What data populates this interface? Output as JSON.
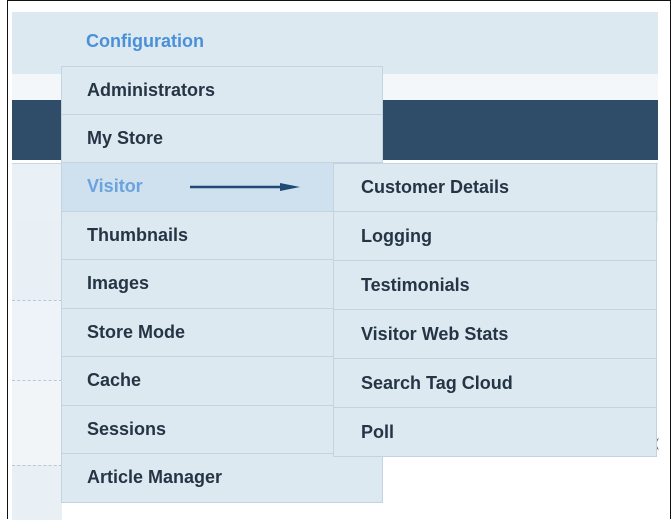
{
  "header": {
    "title": "Configuration"
  },
  "menu": {
    "items": [
      {
        "label": "Administrators"
      },
      {
        "label": "My Store"
      },
      {
        "label": "Visitor",
        "active": true
      },
      {
        "label": "Thumbnails"
      },
      {
        "label": "Images"
      },
      {
        "label": "Store Mode"
      },
      {
        "label": "Cache"
      },
      {
        "label": "Sessions"
      },
      {
        "label": "Article Manager"
      }
    ]
  },
  "submenu": {
    "items": [
      {
        "label": "Customer Details"
      },
      {
        "label": "Logging"
      },
      {
        "label": "Testimonials"
      },
      {
        "label": "Visitor Web Stats"
      },
      {
        "label": "Search Tag Cloud"
      },
      {
        "label": "Poll"
      }
    ]
  },
  "colors": {
    "active_text": "#6aa3dd",
    "header_dark": "#2f4d68",
    "arrow": "#1f4a75"
  }
}
